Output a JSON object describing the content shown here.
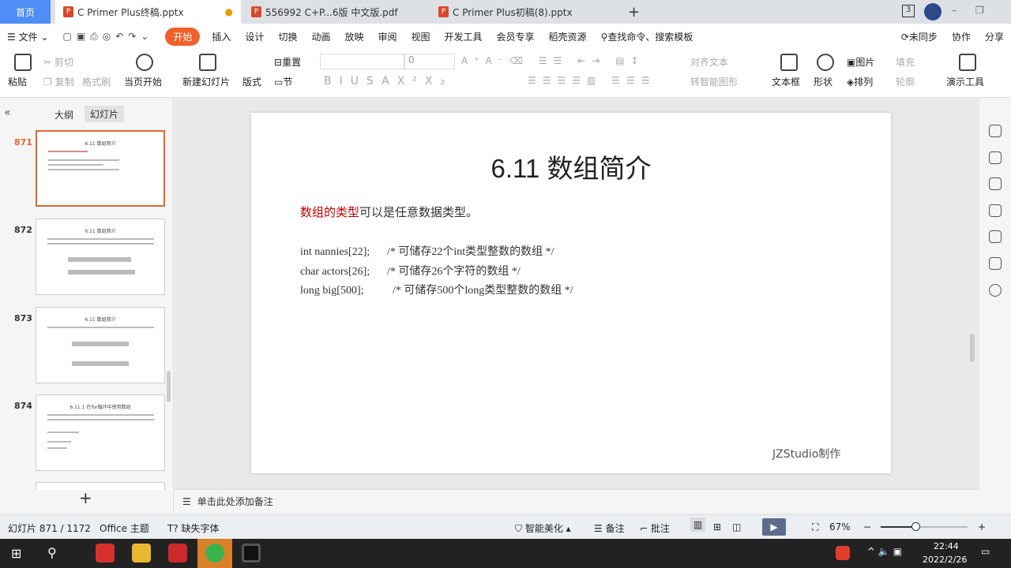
{
  "tabs": {
    "home": "首页",
    "items": [
      {
        "label": "C Primer  Plus终稿.pptx"
      },
      {
        "label": "556992 C+P...6版 中文版.pdf"
      },
      {
        "label": "C Primer  Plus初稿(8).pptx"
      }
    ],
    "new_tab": "+",
    "badge": "3"
  },
  "menu": {
    "file": "文件",
    "items": [
      "开始",
      "插入",
      "设计",
      "切换",
      "动画",
      "放映",
      "审阅",
      "视图",
      "开发工具",
      "会员专享",
      "稻壳资源"
    ],
    "search": "查找命令、搜索模板",
    "sync": "未同步",
    "collab": "协作",
    "share": "分享"
  },
  "ribbon": {
    "paste": "粘贴",
    "cut": "剪切",
    "copy": "复制",
    "format_painter": "格式刷",
    "play_current": "当页开始",
    "new_slide": "新建幻灯片",
    "layout": "版式",
    "section": "节",
    "reset": "重置",
    "font_size": "0",
    "align_text": "对齐文本",
    "smartart": "转智能图形",
    "textbox": "文本框",
    "shape": "形状",
    "picture": "图片",
    "fill": "填充",
    "arrange": "排列",
    "outline": "轮廓",
    "present_tools": "演示工具"
  },
  "left_pane": {
    "tab_outline": "大纲",
    "tab_slides": "幻灯片",
    "add": "+",
    "thumbs": [
      {
        "num": "871",
        "title": "6.11 数组简介"
      },
      {
        "num": "872",
        "title": "6.11 数组简介"
      },
      {
        "num": "873",
        "title": "6.11 数组简介"
      },
      {
        "num": "874",
        "title": "6.11.1 在for循环中使用数组"
      }
    ]
  },
  "slide": {
    "title": "6.11 数组简介",
    "intro_red": "数组的类型",
    "intro_rest": "可以是任意数据类型。",
    "lines": [
      {
        "code": "int nannies[22];",
        "comment": "/* 可储存22个int类型整数的数组  */"
      },
      {
        "code": "char actors[26];",
        "comment": "/* 可储存26个字符的数组  */"
      },
      {
        "code": "long big[500];",
        "comment": "/* 可储存500个long类型整数的数组  */"
      }
    ],
    "footer": "JZStudio制作"
  },
  "notes": {
    "placeholder": "单击此处添加备注"
  },
  "status": {
    "slide_counter": "幻灯片 871 / 1172",
    "theme": "Office 主题",
    "missing_font": "缺失字体",
    "beautify": "智能美化",
    "notes": "备注",
    "comment": "批注",
    "zoom": "67%",
    "zoom_level": 0.4
  },
  "taskbar": {
    "time": "22:44",
    "date": "2022/2/26"
  },
  "colors": {
    "accent": "#f0602a",
    "home_tab": "#4f8ef7",
    "red_text": "#c00000"
  }
}
